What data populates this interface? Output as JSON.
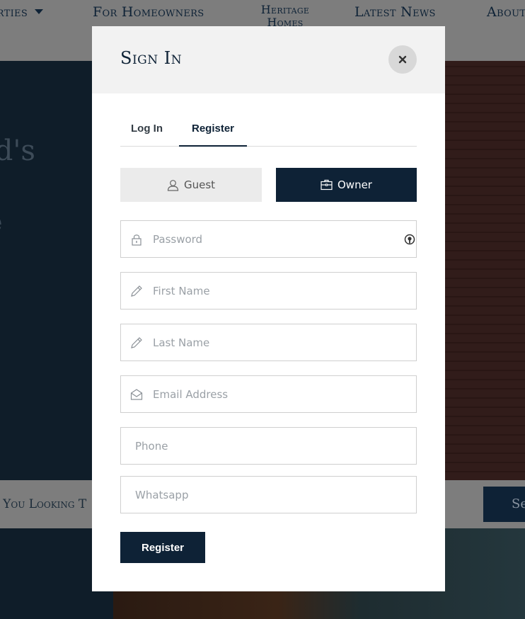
{
  "background": {
    "nav": {
      "items": [
        "Properties",
        "For Homeowners",
        "Heritage Homes",
        "Latest News",
        "About"
      ],
      "properties_visible": "erties",
      "about_visible": "About"
    },
    "hero": {
      "line1_visible": "ld's",
      "line2_visible": "e"
    },
    "search": {
      "placeholder_visible": "e You Looking T",
      "button_visible": "Se"
    }
  },
  "modal": {
    "title": "Sign In",
    "close_glyph": "×",
    "tabs": [
      {
        "label": "Log In",
        "active": false
      },
      {
        "label": "Register",
        "active": true
      }
    ],
    "roles": {
      "guest": "Guest",
      "owner": "Owner",
      "selected": "Owner"
    },
    "fields": {
      "password": {
        "placeholder": "Password",
        "icon": "lock-icon"
      },
      "first_name": {
        "placeholder": "First Name",
        "icon": "pencil-icon"
      },
      "last_name": {
        "placeholder": "Last Name",
        "icon": "pencil-icon"
      },
      "email": {
        "placeholder": "Email Address",
        "icon": "envelope-icon"
      },
      "phone": {
        "placeholder": "Phone"
      },
      "whatsapp": {
        "placeholder": "Whatsapp"
      }
    },
    "submit_label": "Register"
  },
  "colors": {
    "primary": "#0e2236",
    "header_bg": "#f2f2f2",
    "overlay_gray": "#7d7d7d"
  }
}
